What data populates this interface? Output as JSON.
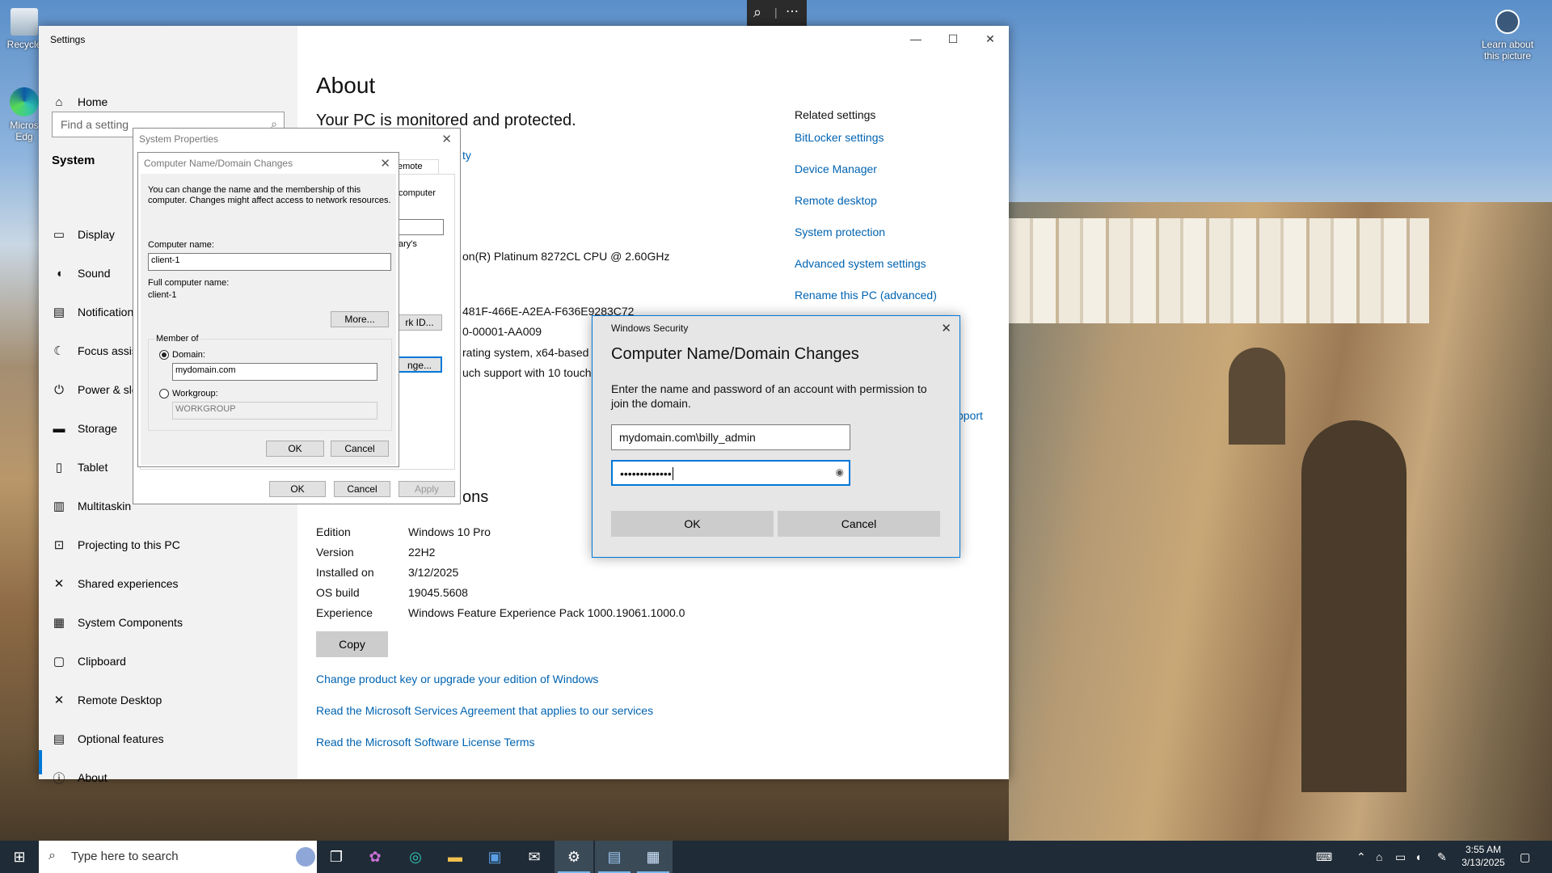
{
  "desktop": {
    "recycle_bin_label": "Recycle",
    "edge_label_1": "Micros",
    "edge_label_2": "Edg",
    "learn_about_line1": "Learn about",
    "learn_about_line2": "this picture"
  },
  "magnifier_bar": {
    "zoom_icon": "magnifier-icon",
    "more_icon": "more-icon"
  },
  "settings": {
    "window_title": "Settings",
    "home_label": "Home",
    "search_placeholder": "Find a setting",
    "section_title": "System",
    "nav_items": [
      {
        "label": "Display",
        "icon": "display-icon"
      },
      {
        "label": "Sound",
        "icon": "sound-icon"
      },
      {
        "label": "Notification",
        "icon": "notifications-icon"
      },
      {
        "label": "Focus assist",
        "icon": "focus-assist-icon"
      },
      {
        "label": "Power & sle",
        "icon": "power-icon"
      },
      {
        "label": "Storage",
        "icon": "storage-icon"
      },
      {
        "label": "Tablet",
        "icon": "tablet-icon"
      },
      {
        "label": "Multitaskin",
        "icon": "multitasking-icon"
      },
      {
        "label": "Projecting to this PC",
        "icon": "projecting-icon"
      },
      {
        "label": "Shared experiences",
        "icon": "shared-experiences-icon"
      },
      {
        "label": "System Components",
        "icon": "system-components-icon"
      },
      {
        "label": "Clipboard",
        "icon": "clipboard-icon"
      },
      {
        "label": "Remote Desktop",
        "icon": "remote-desktop-icon"
      },
      {
        "label": "Optional features",
        "icon": "optional-features-icon"
      },
      {
        "label": "About",
        "icon": "about-icon"
      }
    ],
    "about": {
      "heading": "About",
      "protected_text": "Your PC is monitored and protected.",
      "security_link_fragment": "ty",
      "processor_fragment": "on(R) Platinum 8272CL CPU @ 2.60GHz",
      "device_id_fragment": "481F-466E-A2EA-F636E9283C72",
      "product_id_fragment": "0-00001-AA009",
      "system_type_fragment": "rating system, x64-based p",
      "pen_touch_fragment": "uch support with 10 touch",
      "windows_specs_fragment": "ons",
      "support_fragment": "pport",
      "specs": [
        {
          "label": "Edition",
          "value": "Windows 10 Pro"
        },
        {
          "label": "Version",
          "value": "22H2"
        },
        {
          "label": "Installed on",
          "value": "3/12/2025"
        },
        {
          "label": "OS build",
          "value": "19045.5608"
        },
        {
          "label": "Experience",
          "value": "Windows Feature Experience Pack 1000.19061.1000.0"
        }
      ],
      "copy_button": "Copy",
      "links": [
        "Change product key or upgrade your edition of Windows",
        "Read the Microsoft Services Agreement that applies to our services",
        "Read the Microsoft Software License Terms"
      ]
    },
    "related_settings": {
      "title": "Related settings",
      "links": [
        "BitLocker settings",
        "Device Manager",
        "Remote desktop",
        "System protection",
        "Advanced system settings",
        "Rename this PC (advanced)"
      ]
    }
  },
  "system_properties": {
    "title": "System Properties",
    "tab_fragment": "emote",
    "computer_fragment": "computer",
    "library_fragment": "ary's",
    "network_id_fragment": "rk ID...",
    "change_fragment": "nge...",
    "ok": "OK",
    "cancel": "Cancel",
    "apply": "Apply"
  },
  "name_changes_dialog": {
    "title": "Computer Name/Domain Changes",
    "description_line1": "You can change the name and the membership of this",
    "description_line2": "computer. Changes might affect access to network resources.",
    "computer_name_label": "Computer name:",
    "computer_name_value": "client-1",
    "full_name_label": "Full computer name:",
    "full_name_value": "client-1",
    "more_button": "More...",
    "member_of_label": "Member of",
    "domain_label": "Domain:",
    "domain_value": "mydomain.com",
    "workgroup_label": "Workgroup:",
    "workgroup_value": "WORKGROUP",
    "ok": "OK",
    "cancel": "Cancel"
  },
  "windows_security": {
    "app_title": "Windows Security",
    "heading": "Computer Name/Domain Changes",
    "message_line1": "Enter the name and password of an account with permission to",
    "message_line2": "join the domain.",
    "username_value": "mydomain.com\\billy_admin",
    "password_mask": "•••••••••••••",
    "ok": "OK",
    "cancel": "Cancel"
  },
  "taskbar": {
    "search_placeholder": "Type here to search",
    "time": "3:55 AM",
    "date": "3/13/2025"
  }
}
